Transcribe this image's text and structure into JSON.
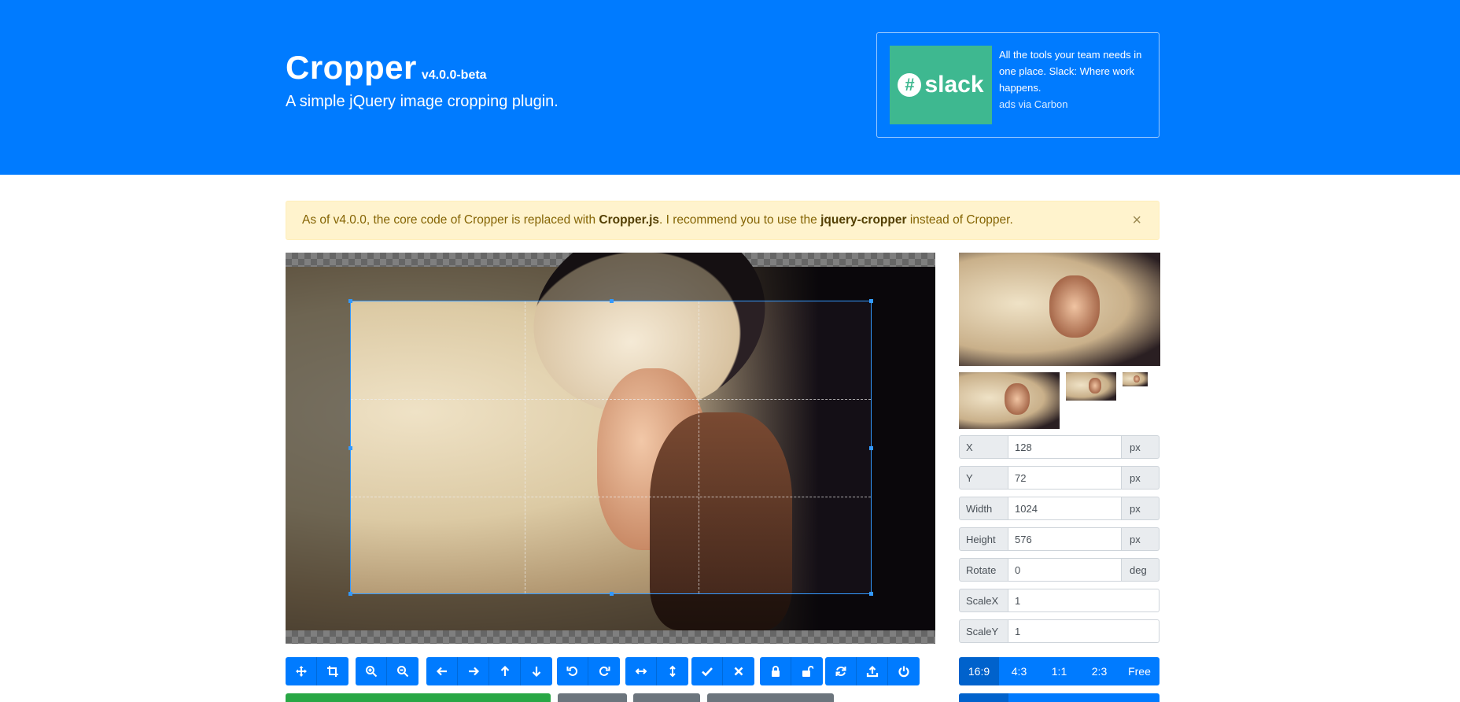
{
  "header": {
    "title": "Cropper",
    "version": "v4.0.0-beta",
    "subtitle": "A simple jQuery image cropping plugin."
  },
  "ad": {
    "logo_text": "slack",
    "logo_mark": "#",
    "text": "All the tools your team needs in one place. Slack: Where work happens.",
    "via": "ads via Carbon"
  },
  "alert": {
    "prefix": "As of v4.0.0, the core code of Cropper is replaced with",
    "strong1": "Cropper.js",
    "middle": ". I recommend you to use the",
    "strong2": "jquery-cropper",
    "suffix": "instead of Cropper.",
    "close": "×"
  },
  "form": [
    {
      "label": "X",
      "value": "128",
      "unit": "px"
    },
    {
      "label": "Y",
      "value": "72",
      "unit": "px"
    },
    {
      "label": "Width",
      "value": "1024",
      "unit": "px"
    },
    {
      "label": "Height",
      "value": "576",
      "unit": "px"
    },
    {
      "label": "Rotate",
      "value": "0",
      "unit": "deg"
    },
    {
      "label": "ScaleX",
      "value": "1",
      "unit": ""
    },
    {
      "label": "ScaleY",
      "value": "1",
      "unit": ""
    }
  ],
  "toolbar_groups": [
    [
      "move-icon",
      "crop-icon"
    ],
    [
      "zoom-in-icon",
      "zoom-out-icon"
    ],
    [
      "arrow-left-icon",
      "arrow-right-icon",
      "arrow-up-icon",
      "arrow-down-icon"
    ],
    [
      "rotate-left-icon",
      "rotate-right-icon"
    ],
    [
      "flip-horizontal-icon",
      "flip-vertical-icon"
    ],
    [
      "check-icon",
      "close-icon"
    ],
    [
      "lock-icon",
      "unlock-icon"
    ],
    [
      "refresh-icon",
      "upload-icon",
      "power-icon"
    ]
  ],
  "aspect_ratios": [
    "16:9",
    "4:3",
    "1:1",
    "2:3",
    "Free"
  ],
  "active_ratio": "16:9",
  "colors": {
    "primary": "#007bff",
    "success": "#28a745",
    "secondary": "#6c757d",
    "alert_bg": "#fff3cd"
  }
}
